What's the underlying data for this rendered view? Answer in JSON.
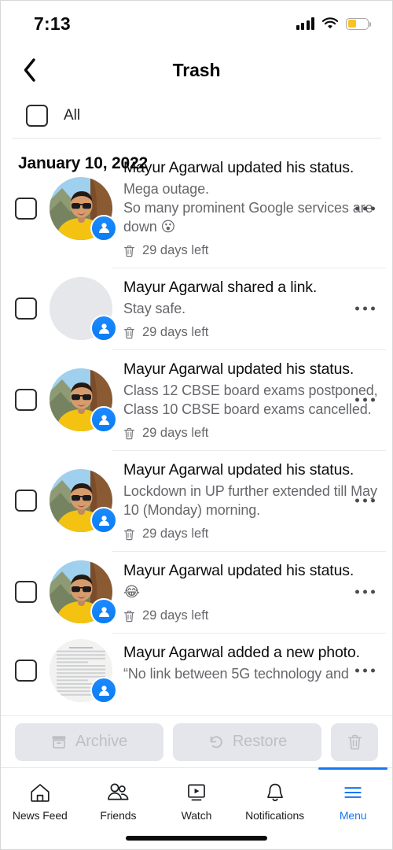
{
  "status_bar": {
    "time": "7:13",
    "signal_icon": "cellular-bars-icon",
    "wifi_icon": "wifi-icon",
    "battery_icon": "battery-low-power-icon",
    "battery_level_pct": 42,
    "battery_color": "#f7c325"
  },
  "header": {
    "back_icon": "chevron-left-icon",
    "title": "Trash"
  },
  "select_all": {
    "checked": false,
    "label": "All"
  },
  "date_header": "January 10, 2022",
  "items": [
    {
      "title": "Mayur Agarwal updated his status.",
      "snippet": "Mega outage.\nSo many prominent Google services are down 😮",
      "expiry": "29 days left",
      "expiry_icon": "trash-icon",
      "avatar_type": "photo-portrait",
      "badge_icon": "profile-update-icon",
      "menu_icon": "more-options-icon",
      "checked": false
    },
    {
      "title": "Mayur Agarwal shared a link.",
      "snippet": "Stay safe.",
      "expiry": "29 days left",
      "expiry_icon": "trash-icon",
      "avatar_type": "placeholder-blank",
      "badge_icon": "profile-update-icon",
      "menu_icon": "more-options-icon",
      "checked": false
    },
    {
      "title": "Mayur Agarwal updated his status.",
      "snippet": "Class 12 CBSE board exams postponed, Class 10 CBSE board exams cancelled.",
      "expiry": "29 days left",
      "expiry_icon": "trash-icon",
      "avatar_type": "photo-portrait",
      "badge_icon": "profile-update-icon",
      "menu_icon": "more-options-icon",
      "checked": false
    },
    {
      "title": "Mayur Agarwal updated his status.",
      "snippet": "Lockdown in UP further extended till May 10 (Monday) morning.",
      "expiry": "29 days left",
      "expiry_icon": "trash-icon",
      "avatar_type": "photo-portrait",
      "badge_icon": "profile-update-icon",
      "menu_icon": "more-options-icon",
      "checked": false
    },
    {
      "title": "Mayur Agarwal updated his status.",
      "snippet": "😂",
      "expiry": "29 days left",
      "expiry_icon": "trash-icon",
      "avatar_type": "photo-portrait",
      "badge_icon": "profile-update-icon",
      "menu_icon": "more-options-icon",
      "checked": false
    },
    {
      "title": "Mayur Agarwal added a new photo.",
      "snippet": "“No link between 5G technology and",
      "expiry": "",
      "expiry_icon": "trash-icon",
      "avatar_type": "document-photo",
      "badge_icon": "profile-update-icon",
      "menu_icon": "more-options-icon",
      "checked": false
    }
  ],
  "action_bar": {
    "archive_label": "Archive",
    "archive_icon": "archive-box-icon",
    "restore_label": "Restore",
    "restore_icon": "restore-arrow-icon",
    "delete_icon": "trash-icon",
    "disabled": true,
    "disabled_text_color": "#bcc0c4",
    "button_bg": "#e4e6eb"
  },
  "tab_bar": {
    "active_color": "#1877f2",
    "tabs": [
      {
        "label": "News Feed",
        "icon": "home-icon",
        "active": false
      },
      {
        "label": "Friends",
        "icon": "friends-icon",
        "active": false
      },
      {
        "label": "Watch",
        "icon": "watch-video-icon",
        "active": false
      },
      {
        "label": "Notifications",
        "icon": "bell-icon",
        "active": false
      },
      {
        "label": "Menu",
        "icon": "hamburger-menu-icon",
        "active": true
      }
    ]
  }
}
